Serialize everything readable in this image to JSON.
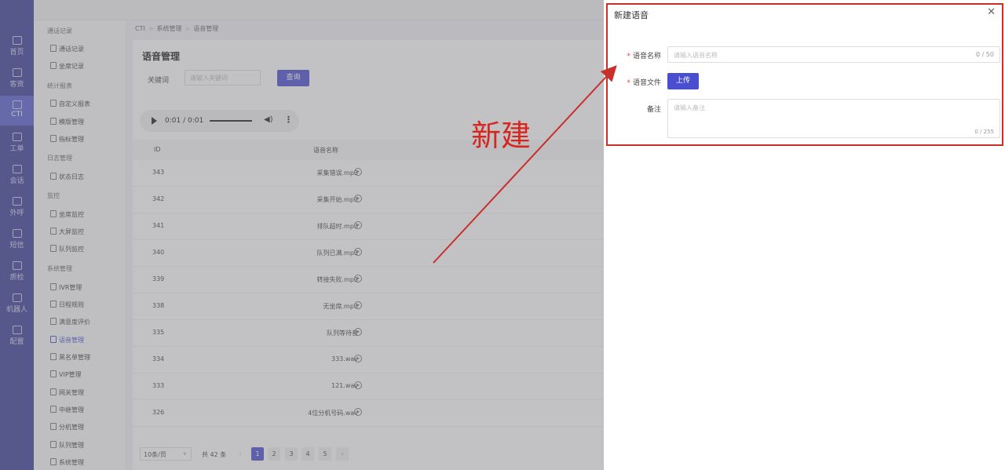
{
  "rail": [
    {
      "label": "首页",
      "icon": "home-icon"
    },
    {
      "label": "客资",
      "icon": "users-icon"
    },
    {
      "label": "CTI",
      "icon": "cti-icon",
      "active": true
    },
    {
      "label": "工单",
      "icon": "ticket-icon"
    },
    {
      "label": "会话",
      "icon": "chat-icon"
    },
    {
      "label": "外呼",
      "icon": "phone-icon"
    },
    {
      "label": "短信",
      "icon": "sms-icon"
    },
    {
      "label": "质检",
      "icon": "inspect-icon"
    },
    {
      "label": "机器人",
      "icon": "robot-icon"
    },
    {
      "label": "配置",
      "icon": "settings-icon"
    }
  ],
  "subnav": {
    "groups": [
      "通话记录",
      "统计报表",
      "日志管理",
      "监控",
      "系统管理"
    ],
    "items": [
      "通话记录",
      "坐席记录",
      "自定义报表",
      "模版管理",
      "指标管理",
      "状态日志",
      "坐席监控",
      "大屏监控",
      "队列监控",
      "IVR管理",
      "日程规则",
      "满意度评价",
      "语音管理",
      "黑名单管理",
      "VIP管理",
      "网关管理",
      "中继管理",
      "分机管理",
      "队列管理",
      "系统管理"
    ]
  },
  "breadcrumb": [
    "CTI",
    "系统管理",
    "语音管理"
  ],
  "page_title": "语音管理",
  "search": {
    "label": "关键词",
    "placeholder": "请输入关键词",
    "button": "查询"
  },
  "audio": {
    "time": "0:01 / 0:01"
  },
  "table": {
    "headers": [
      "ID",
      "语音名称"
    ],
    "rows": [
      {
        "id": "343",
        "name": "采集错误.mp3"
      },
      {
        "id": "342",
        "name": "采集开始.mp3"
      },
      {
        "id": "341",
        "name": "排队超时.mp3"
      },
      {
        "id": "340",
        "name": "队列已满.mp3"
      },
      {
        "id": "339",
        "name": "转接失败.mp3"
      },
      {
        "id": "338",
        "name": "无坐席.mp3"
      },
      {
        "id": "335",
        "name": "队列等待音"
      },
      {
        "id": "334",
        "name": "333.wav"
      },
      {
        "id": "333",
        "name": "121.wav"
      },
      {
        "id": "326",
        "name": "4位分机号码.wav"
      }
    ]
  },
  "pagination": {
    "page_size": "10条/页",
    "total": "共 42 条",
    "pages": [
      "1",
      "2",
      "3",
      "4",
      "5"
    ],
    "current": "1",
    "prev": "‹",
    "next": "›"
  },
  "drawer": {
    "title": "新建语音",
    "close": "✕",
    "required_mark": "*",
    "name_label": "语音名称",
    "name_placeholder": "请输入语音名称",
    "name_count": "0 / 50",
    "file_label": "语音文件",
    "upload_button": "上传",
    "note_label": "备注",
    "note_placeholder": "请输入备注",
    "note_count": "0 / 255"
  },
  "annotation": {
    "text": "新建",
    "color": "#d7261e"
  },
  "colors": {
    "primary": "#4a4fd0",
    "rail": "#3b3e9a",
    "annotation": "#c9302c"
  }
}
